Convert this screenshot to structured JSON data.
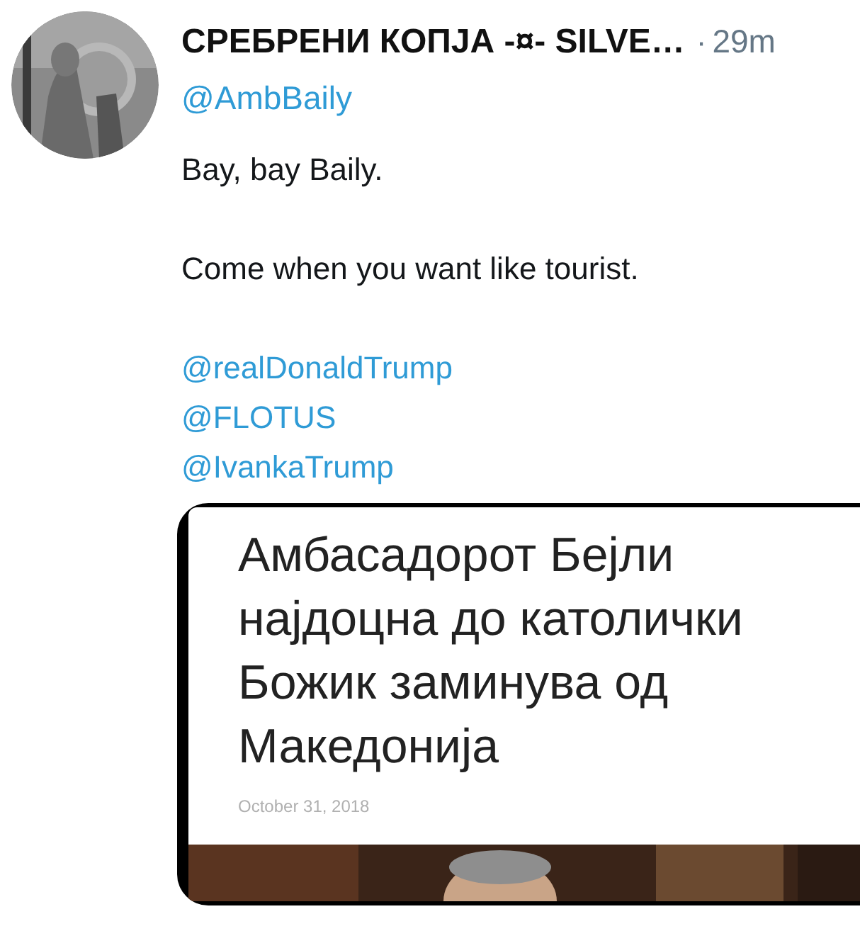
{
  "tweet": {
    "author_name": "СРЕБРЕНИ КОПЈА -¤- SILVE…",
    "separator": "·",
    "time": "29m",
    "reply_to": "@AmbBaily",
    "paragraphs": [
      "Bay, bay Baily.",
      "Come when you want like tourist."
    ],
    "mentions": [
      "@realDonaldTrump",
      "@FLOTUS",
      "@IvankaTrump"
    ],
    "attachment": {
      "headline": "Амбасадорот Бејли најдоцна до католички Божик заминува од Македонија",
      "date": "October 31, 2018"
    }
  }
}
